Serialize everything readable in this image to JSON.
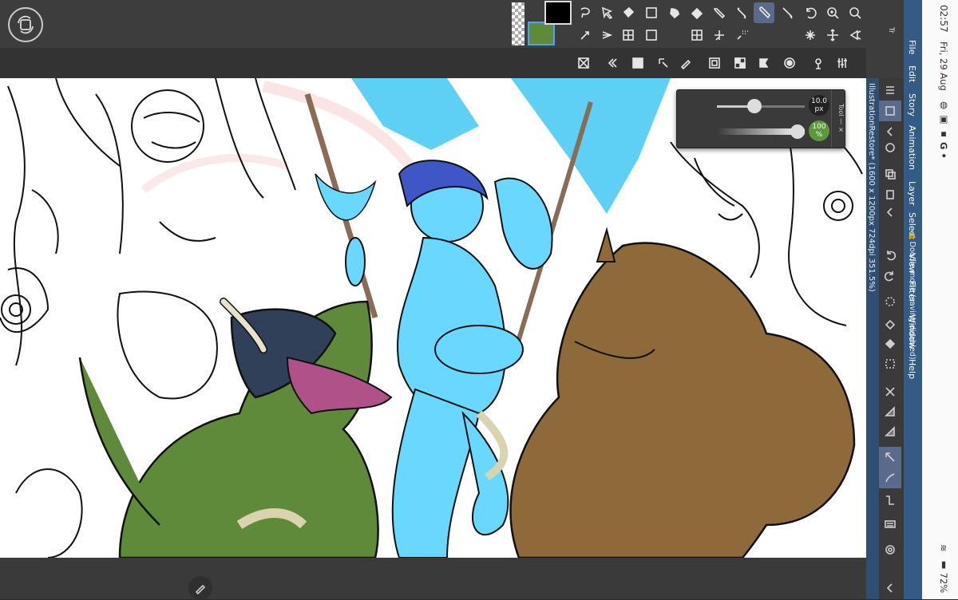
{
  "status_bar": {
    "time": "02:57",
    "date": "Fri, 29 Aug",
    "battery": "72%",
    "icons": [
      "signal-icon",
      "google-icon",
      "gallery-icon"
    ]
  },
  "menu": {
    "items": [
      "File",
      "Edit",
      "Story",
      "Animation",
      "Layer",
      "Select",
      "View",
      "Filter",
      "Window",
      "Help"
    ]
  },
  "document": {
    "title": "IllustrationRestore* (1600 x 1200px 724dpi 351.5%)",
    "mode": "Doodle mode (saving disabled)"
  },
  "tool_property": {
    "size_value": "10.0",
    "size_unit": "px",
    "opacity_value": "100",
    "opacity_unit": "%",
    "panel_label": "Tool"
  },
  "top_right": {
    "tab_label": "Tr"
  },
  "colors": {
    "main": "#000000",
    "sub": "#5f8a3a",
    "accent": "#345b86",
    "selected_tool": "#5a6a8a"
  },
  "tools_row1": [
    "lasso-icon",
    "select-arrow-icon",
    "fill-icon",
    "gradient-icon",
    "blend-icon",
    "eraser-icon",
    "pen-icon",
    "marker-icon",
    "pencil-icon",
    "brush-icon",
    "undo-stroke-icon",
    "zoom-icon",
    "search-icon",
    "dropper-icon"
  ],
  "tools_row2": [
    "move-icon",
    "text-icon",
    "frame-icon",
    "rect-select-icon",
    "grid-icon",
    "transform-icon",
    "sparkle-icon",
    "star-icon",
    "pan-icon",
    "broom-icon"
  ],
  "tools_row3": [
    "clear-icon",
    "prev-icon",
    "layout-icon",
    "link-icon",
    "frame2-icon",
    "checker-icon",
    "flag-icon",
    "target-icon",
    "pin-icon",
    "settings-sliders-icon",
    "zoom-reset-icon"
  ]
}
